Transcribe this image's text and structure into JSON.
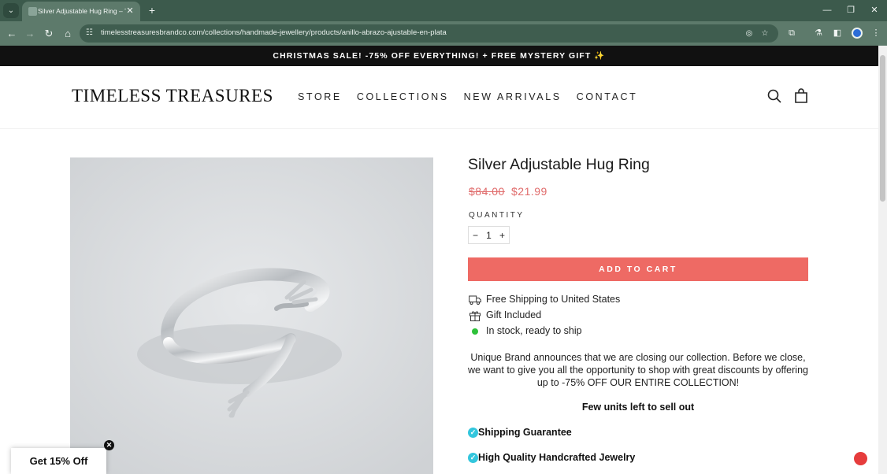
{
  "browser": {
    "tab_title": "Silver Adjustable Hug Ring – Ti",
    "new_tab": "+",
    "url": "timelesstreasuresbrandco.com/collections/handmade-jewellery/products/anillo-abrazo-ajustable-en-plata",
    "icons": [
      "tab-search-icon",
      "back-icon",
      "forward-icon",
      "reload-icon",
      "home-icon",
      "site-settings-icon",
      "eye-off-icon",
      "star-icon",
      "extensions-icon",
      "labs-icon",
      "sidebar-icon",
      "profile-icon",
      "menu-icon"
    ]
  },
  "announcement": "CHRISTMAS SALE! -75% OFF EVERYTHING! + FREE MYSTERY GIFT ✨",
  "header": {
    "logo": "TIMELESS TREASURES",
    "nav": [
      "STORE",
      "COLLECTIONS",
      "NEW ARRIVALS",
      "CONTACT"
    ]
  },
  "product": {
    "title": "Silver Adjustable Hug Ring",
    "price_old": "$84.00",
    "price_new": "$21.99",
    "quantity_label": "QUANTITY",
    "quantity": "1",
    "minus": "−",
    "plus": "+",
    "add_to_cart": "ADD TO CART",
    "features": [
      "Free Shipping to United States",
      "Gift Included",
      "In stock, ready to ship"
    ],
    "description": "Unique Brand announces that we are closing our collection. Before we close, we want to give you all the opportunity to shop with great discounts by offering up to -75% OFF OUR ENTIRE COLLECTION!",
    "few_units": "Few units left to sell out",
    "guarantees": [
      "Shipping Guarantee",
      "High Quality Handcrafted Jewelry"
    ]
  },
  "promo": {
    "label": "Get 15% Off"
  },
  "colors": {
    "accent": "#ee6a64",
    "price": "#e06b6b",
    "check": "#33c6dd",
    "in_stock": "#2ec13a",
    "chrome": "#5d7a6b"
  }
}
